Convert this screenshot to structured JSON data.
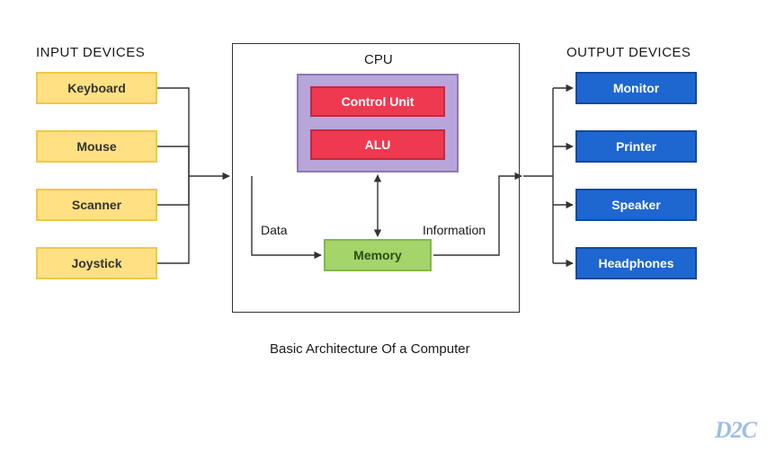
{
  "title": "Basic Architecture Of a Computer",
  "headings": {
    "input": "INPUT DEVICES",
    "output": "OUTPUT DEVICES"
  },
  "input_devices": [
    "Keyboard",
    "Mouse",
    "Scanner",
    "Joystick"
  ],
  "output_devices": [
    "Monitor",
    "Printer",
    "Speaker",
    "Headphones"
  ],
  "cpu": {
    "label": "CPU",
    "control_unit": "Control Unit",
    "alu": "ALU"
  },
  "memory": "Memory",
  "flow": {
    "data": "Data",
    "information": "Information"
  },
  "watermark": "D2C",
  "colors": {
    "input_bg": "#ffe082",
    "input_border": "#f0c845",
    "output_bg": "#1e66d0",
    "output_border": "#144a9c",
    "cpu_inner_bg": "#b8a5d9",
    "cpu_inner_border": "#8d77b8",
    "cu_bg": "#ef3950",
    "cu_border": "#c22a3e",
    "memory_bg": "#a5d46a",
    "memory_border": "#7fb94b"
  },
  "chart_data": {
    "type": "diagram",
    "nodes": [
      {
        "id": "keyboard",
        "group": "input",
        "label": "Keyboard"
      },
      {
        "id": "mouse",
        "group": "input",
        "label": "Mouse"
      },
      {
        "id": "scanner",
        "group": "input",
        "label": "Scanner"
      },
      {
        "id": "joystick",
        "group": "input",
        "label": "Joystick"
      },
      {
        "id": "cpu",
        "group": "cpu",
        "label": "CPU"
      },
      {
        "id": "control_unit",
        "group": "cpu",
        "label": "Control Unit",
        "parent": "cpu"
      },
      {
        "id": "alu",
        "group": "cpu",
        "label": "ALU",
        "parent": "cpu"
      },
      {
        "id": "memory",
        "group": "memory",
        "label": "Memory"
      },
      {
        "id": "monitor",
        "group": "output",
        "label": "Monitor"
      },
      {
        "id": "printer",
        "group": "output",
        "label": "Printer"
      },
      {
        "id": "speaker",
        "group": "output",
        "label": "Speaker"
      },
      {
        "id": "headphones",
        "group": "output",
        "label": "Headphones"
      }
    ],
    "edges": [
      {
        "from": "keyboard",
        "to": "memory",
        "label": "Data"
      },
      {
        "from": "mouse",
        "to": "memory",
        "label": "Data"
      },
      {
        "from": "scanner",
        "to": "memory",
        "label": "Data"
      },
      {
        "from": "joystick",
        "to": "memory",
        "label": "Data"
      },
      {
        "from": "cpu",
        "to": "memory",
        "bidirectional": true
      },
      {
        "from": "memory",
        "to": "monitor",
        "label": "Information"
      },
      {
        "from": "memory",
        "to": "printer",
        "label": "Information"
      },
      {
        "from": "memory",
        "to": "speaker",
        "label": "Information"
      },
      {
        "from": "memory",
        "to": "headphones",
        "label": "Information"
      }
    ]
  }
}
